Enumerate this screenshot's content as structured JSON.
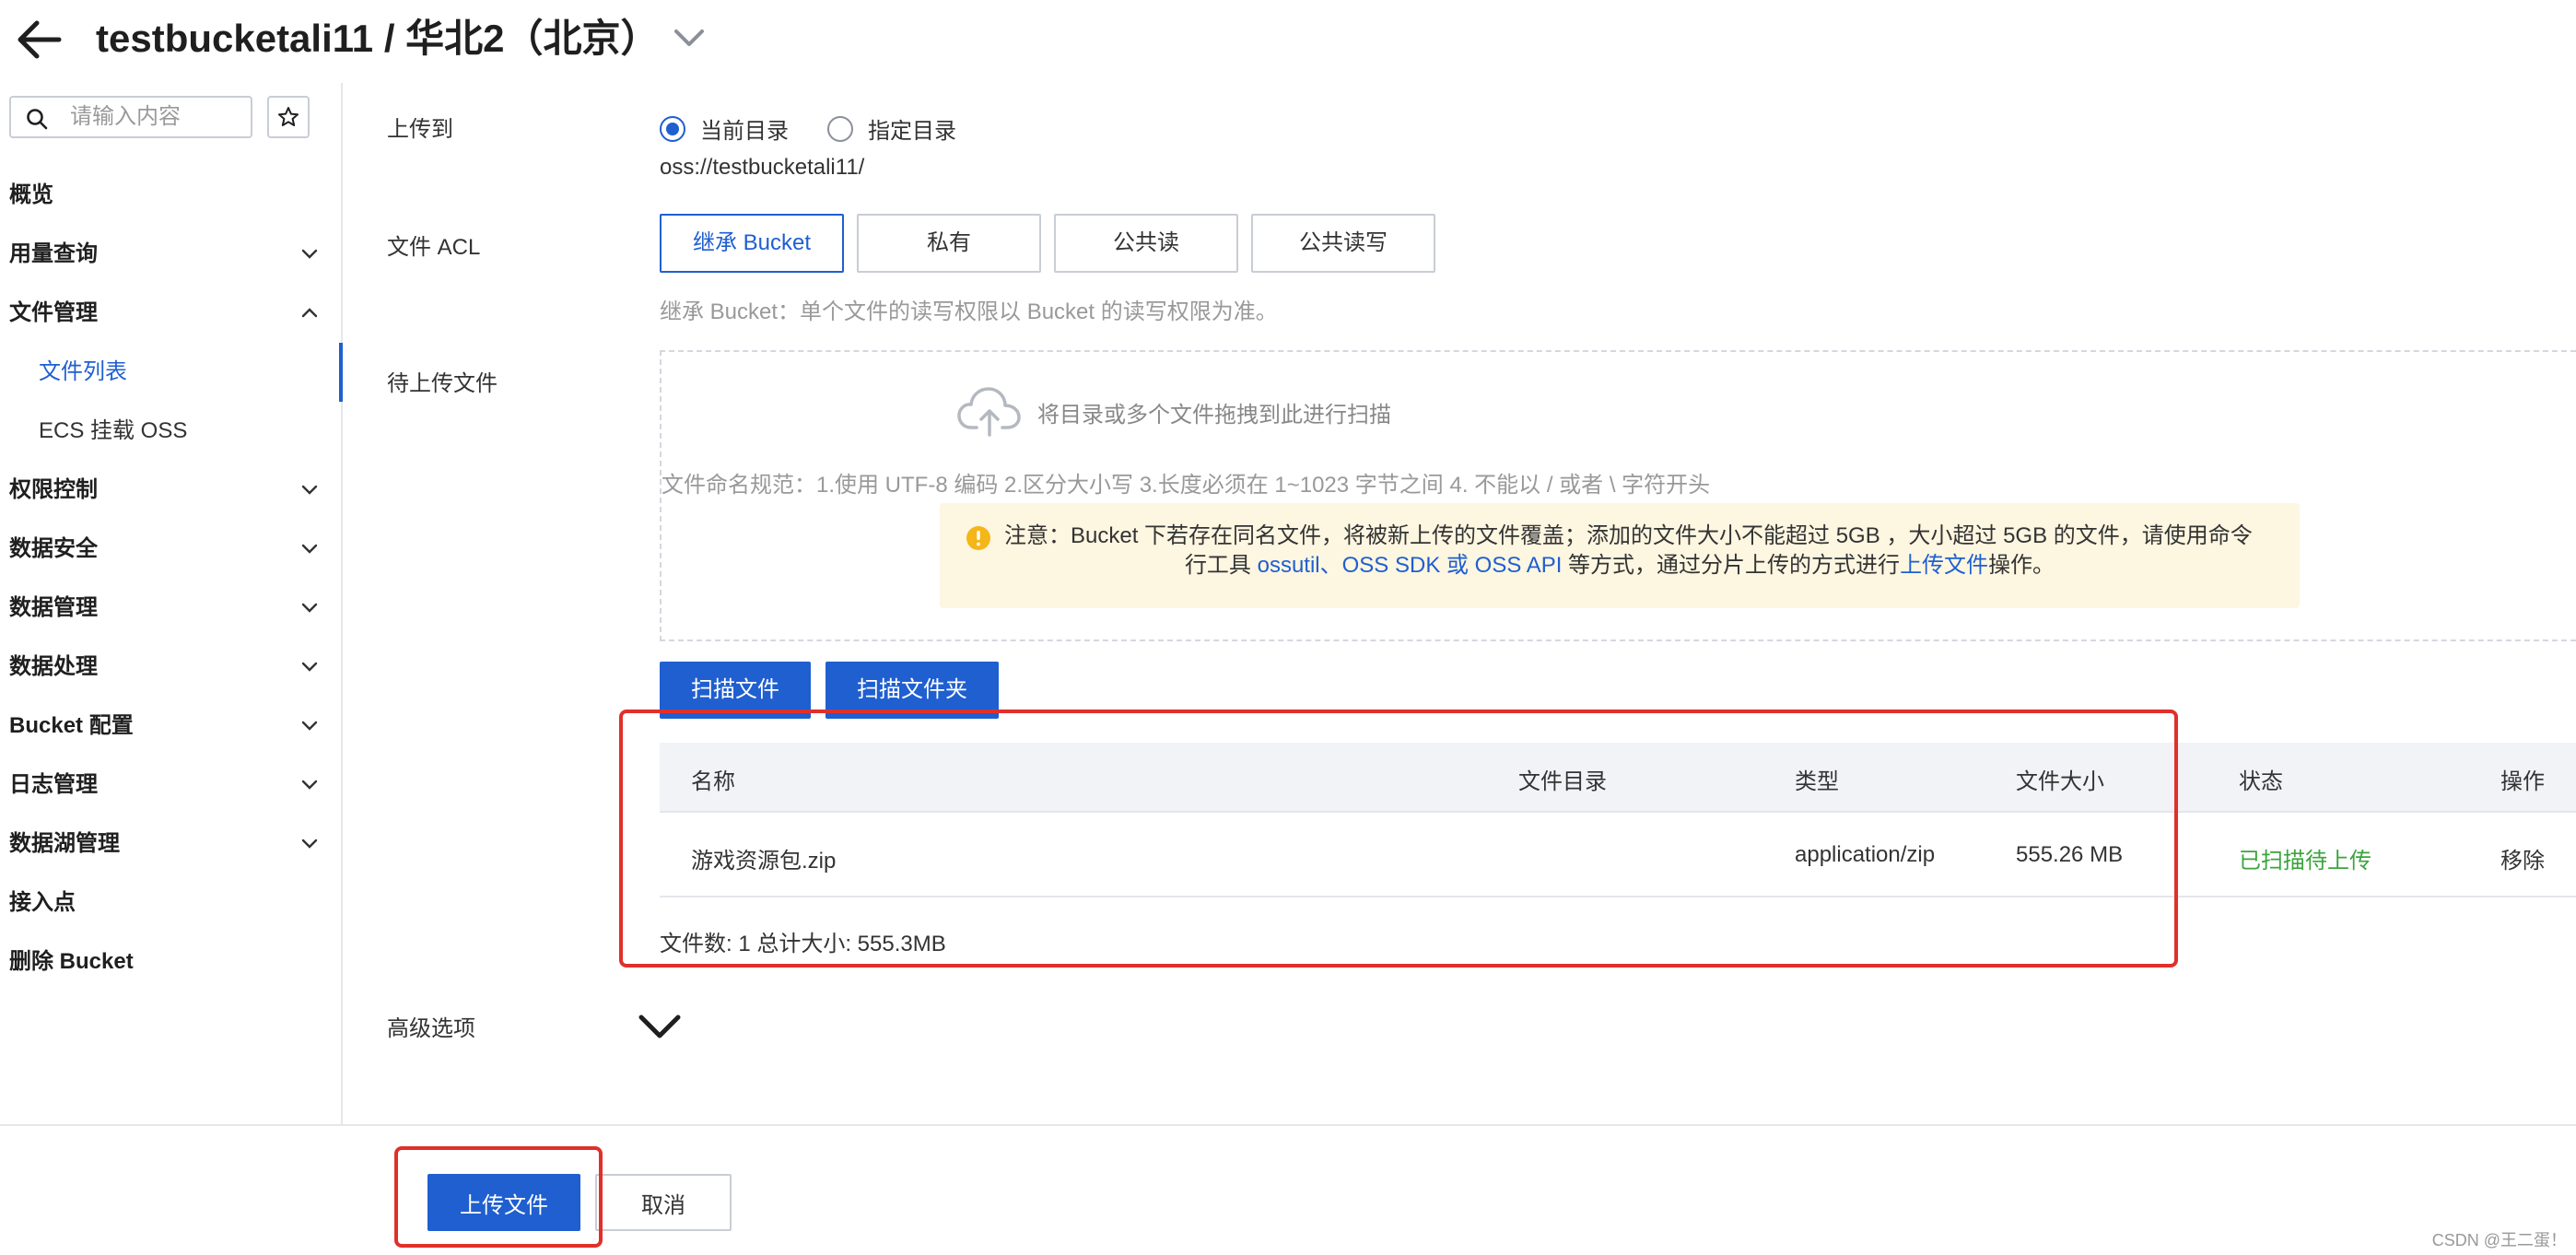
{
  "header": {
    "title": "testbucketali11 / 华北2（北京）"
  },
  "sidebar": {
    "search_placeholder": "请输入内容",
    "items": [
      {
        "label": "概览",
        "has_chevron": false
      },
      {
        "label": "用量查询",
        "has_chevron": true,
        "chevron": "down"
      },
      {
        "label": "文件管理",
        "has_chevron": true,
        "chevron": "up"
      },
      {
        "label": "文件列表",
        "sub": true,
        "active": true
      },
      {
        "label": "ECS 挂载 OSS",
        "sub": true
      },
      {
        "label": "权限控制",
        "has_chevron": true,
        "chevron": "down"
      },
      {
        "label": "数据安全",
        "has_chevron": true,
        "chevron": "down"
      },
      {
        "label": "数据管理",
        "has_chevron": true,
        "chevron": "down"
      },
      {
        "label": "数据处理",
        "has_chevron": true,
        "chevron": "down"
      },
      {
        "label": "Bucket 配置",
        "has_chevron": true,
        "chevron": "down"
      },
      {
        "label": "日志管理",
        "has_chevron": true,
        "chevron": "down"
      },
      {
        "label": "数据湖管理",
        "has_chevron": true,
        "chevron": "down"
      },
      {
        "label": "接入点",
        "has_chevron": false
      },
      {
        "label": "删除 Bucket",
        "has_chevron": false
      }
    ]
  },
  "form": {
    "upload_to_label": "上传到",
    "radio_current": "当前目录",
    "radio_specified": "指定目录",
    "selected_radio": "当前目录",
    "oss_path": "oss://testbucketali11/",
    "acl_label": "文件 ACL",
    "acl_options": [
      "继承 Bucket",
      "私有",
      "公共读",
      "公共读写"
    ],
    "acl_selected": "继承 Bucket",
    "acl_hint": "继承 Bucket：单个文件的读写权限以 Bucket 的读写权限为准。",
    "pending_label": "待上传文件",
    "dropzone_text": "将目录或多个文件拖拽到此进行扫描",
    "naming_rules": "文件命名规范：1.使用 UTF-8 编码 2.区分大小写 3.长度必须在 1~1023 字节之间 4. 不能以 / 或者 \\ 字符开头",
    "warning_line1": "注意：Bucket 下若存在同名文件，将被新上传的文件覆盖；添加的文件大小不能超过 5GB ，大小超过 5GB 的文件，请使用命令",
    "warning_line2_prefix": "行工具 ",
    "warning_line2_link": "ossutil、OSS SDK 或 OSS API",
    "warning_line2_mid": " 等方式，通过分片上传的方式进行",
    "warning_line2_link2": "上传文件",
    "warning_line2_suffix": "操作。",
    "scan_file_btn": "扫描文件",
    "scan_folder_btn": "扫描文件夹",
    "advanced_label": "高级选项"
  },
  "table": {
    "columns": [
      "名称",
      "文件目录",
      "类型",
      "文件大小",
      "状态",
      "操作"
    ],
    "rows": [
      {
        "name": "游戏资源包.zip",
        "dir": "",
        "type": "application/zip",
        "size": "555.26 MB",
        "status": "已扫描待上传",
        "action": "移除"
      }
    ],
    "summary": "文件数: 1  总计大小: 555.3MB"
  },
  "footer": {
    "upload_btn": "上传文件",
    "cancel_btn": "取消",
    "watermark": "CSDN @王二蛋！"
  },
  "colors": {
    "primary": "#1f5fd0",
    "success": "#3ba43c",
    "highlight": "#e0302a",
    "warning_bg": "#fdf6e1"
  }
}
